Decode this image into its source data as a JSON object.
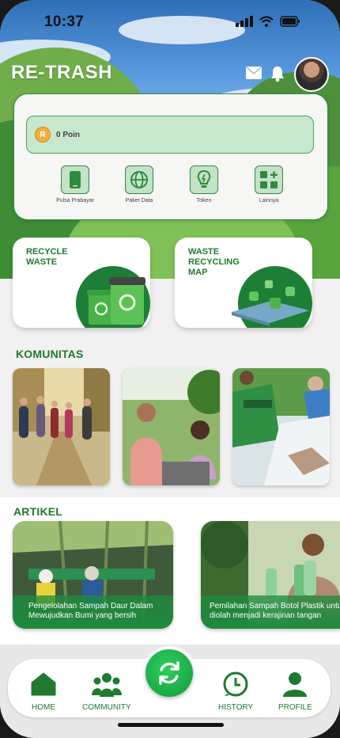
{
  "status": {
    "time": "10:37"
  },
  "app": {
    "logo": "RE-TRASH",
    "header_icons": [
      "mail-icon",
      "bell-icon"
    ]
  },
  "wallet": {
    "coin_letter": "R",
    "points_label": "0 Poin",
    "menu": [
      {
        "label": "Pulsa Prabayar",
        "icon": "phone-icon"
      },
      {
        "label": "Paket Data",
        "icon": "globe-icon"
      },
      {
        "label": "Token",
        "icon": "bulb-icon"
      },
      {
        "label": "Lainnya",
        "icon": "grid-plus-icon"
      }
    ]
  },
  "features": [
    {
      "title": "RECYCLE\nWASTE",
      "icon": "recycle-bins-icon"
    },
    {
      "title": "WASTE\nRECYCLING\nMAP",
      "icon": "map-pins-icon"
    }
  ],
  "community": {
    "title": "KOMUNITAS"
  },
  "articles": {
    "title": "ARTIKEL",
    "items": [
      {
        "caption": "Pengelolahan Sampah Daur Dalam\nMewujudkan Bumi yang bersih"
      },
      {
        "caption": "Pemilahan Sampah Botol Plastik untuk\ndiolah menjadi kerajinan tangan"
      }
    ]
  },
  "nav": {
    "items": [
      {
        "label": "HOME",
        "icon": "home-icon"
      },
      {
        "label": "COMMUNITY",
        "icon": "people-icon"
      },
      {
        "label": "HISTORY",
        "icon": "history-icon"
      },
      {
        "label": "PROFILE",
        "icon": "person-icon"
      }
    ],
    "center_icon": "recycle-arrows-icon"
  },
  "colors": {
    "brand": "#1f7a30",
    "accent": "#1d8f3b",
    "points_bg": "#c7e8cd"
  }
}
